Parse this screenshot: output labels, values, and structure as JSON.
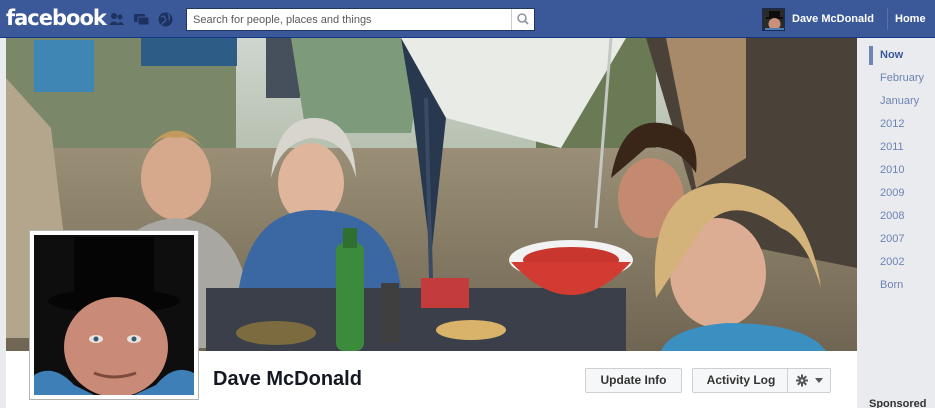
{
  "topbar": {
    "logo": "facebook",
    "search_placeholder": "Search for people, places and things",
    "user_name": "Dave McDonald",
    "home_label": "Home"
  },
  "profile": {
    "name": "Dave McDonald"
  },
  "actions": {
    "update_info": "Update Info",
    "activity_log": "Activity Log"
  },
  "timeline": {
    "items": [
      "Now",
      "February",
      "January",
      "2012",
      "2011",
      "2010",
      "2009",
      "2008",
      "2007",
      "2002",
      "Born"
    ]
  },
  "sidebar": {
    "sponsored": "Sponsored"
  },
  "colors": {
    "brand": "#3b5998",
    "scrubber_text": "#6d84b4"
  }
}
